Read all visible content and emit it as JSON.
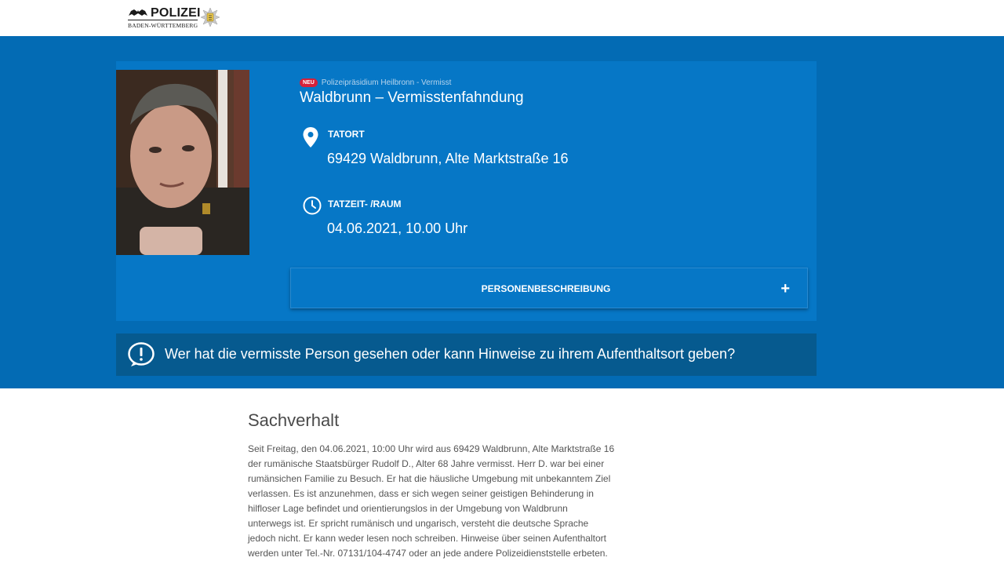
{
  "header": {
    "logo": {
      "title": "POLIZEI",
      "subtitle": "BADEN-WÜRTTEMBERG"
    }
  },
  "case": {
    "badge": "NEU",
    "source": "Polizeipräsidium Heilbronn - Vermisst",
    "title": "Waldbrunn – Vermisstenfahndung",
    "location_label": "TATORT",
    "location_value": "69429 Waldbrunn, Alte Marktstraße 16",
    "time_label": "TATZEIT- /RAUM",
    "time_value": "04.06.2021, 10.00 Uhr",
    "accordion_label": "PERSONENBESCHREIBUNG",
    "accordion_icon": "+"
  },
  "callout": {
    "text": "Wer hat die vermisste Person gesehen oder kann Hinweise zu ihrem Aufenthaltsort geben?"
  },
  "section": {
    "title": "Sachverhalt",
    "lines": [
      "Seit Freitag, den 04.06.2021, 10:00 Uhr wird aus 69429 Waldbrunn, Alte Marktstraße 16",
      "der rumänische Staatsbürger Rudolf D., Alter 68 Jahre vermisst. Herr D. war bei einer",
      "rumänsichen Familie zu Besuch. Er hat die häusliche Umgebung mit unbekanntem Ziel",
      "verlassen. Es ist anzunehmen, dass er sich wegen seiner geistigen Behinderung in",
      "hilfloser Lage befindet und orientierungslos in der Umgebung von Waldbrunn",
      "unterwegs ist. Er spricht rumänisch und ungarisch, versteht die deutsche Sprache",
      "jedoch nicht. Er kann weder lesen noch schreiben. Hinweise über seinen Aufenthaltort",
      "werden unter Tel.-Nr. 07131/104-4747 oder an jede andere Polizeidienststelle erbeten."
    ]
  },
  "colors": {
    "hero_bg": "#036bb4",
    "card_bg": "#0677c6",
    "callout_bg": "#065a8f",
    "badge_red": "#d5213a"
  },
  "icons": {
    "location": "map-pin-icon",
    "time": "clock-icon",
    "callout": "exclamation-circle-icon",
    "expand": "plus-icon"
  }
}
